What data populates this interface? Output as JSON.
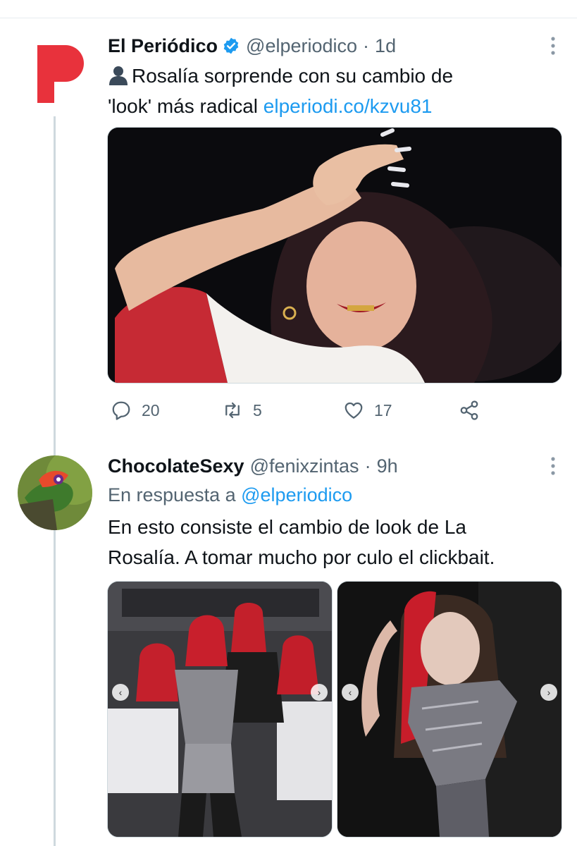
{
  "colors": {
    "accent": "#1d9bf0",
    "secondary_text": "#536471",
    "brand_red": "#e8323c"
  },
  "tweet1": {
    "name": "El Periódico",
    "handle": "@elperiodico",
    "separator": "·",
    "time": "1d",
    "text_line1": "Rosalía sorprende con su cambio de",
    "text_line2": "'look' más radical ",
    "link": "elperiodi.co/kzvu81",
    "actions": {
      "replies": "20",
      "retweets": "5",
      "likes": "17"
    }
  },
  "tweet2": {
    "name": "ChocolateSexy",
    "handle": "@fenixzintas",
    "separator": "·",
    "time": "9h",
    "reply_prefix": "En respuesta a ",
    "reply_handle": "@elperiodico",
    "text_line1": "En esto consiste el cambio de look de La",
    "text_line2": "Rosalía. A tomar mucho por culo el clickbait."
  },
  "icons": {
    "person": "person-icon",
    "verified": "verified-badge-icon",
    "more": "more-options-icon",
    "reply": "reply-icon",
    "retweet": "retweet-icon",
    "like": "heart-icon",
    "share": "share-icon",
    "prev": "chevron-left-icon",
    "next": "chevron-right-icon"
  }
}
